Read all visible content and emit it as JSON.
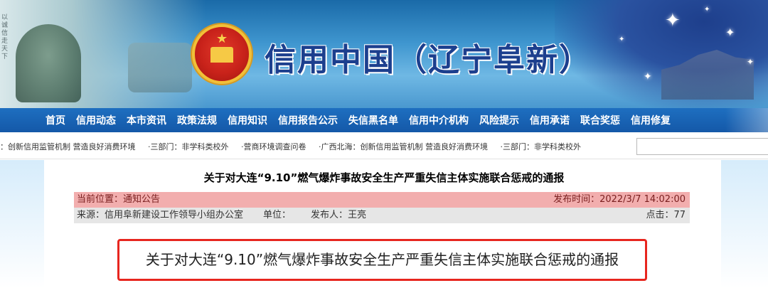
{
  "banner": {
    "site_title": "信用中国（辽宁阜新）",
    "vertical_text": "以诚信走天下"
  },
  "nav": {
    "items": [
      "首页",
      "信用动态",
      "本市资讯",
      "政策法规",
      "信用知识",
      "信用报告公示",
      "失信黑名单",
      "信用中介机构",
      "风险提示",
      "信用承诺",
      "联合奖惩",
      "信用修复"
    ]
  },
  "ticker": {
    "items": [
      "：创新信用监管机制 营造良好消费环境",
      "·三部门：非学科类校外",
      "·营商环境调查问卷",
      "·广西北海：创新信用监管机制 营造良好消费环境",
      "·三部门：非学科类校外"
    ],
    "search_value": ""
  },
  "article": {
    "headline": "关于对大连“9.10”燃气爆炸事故安全生产严重失信主体实施联合惩戒的通报",
    "location_label": "当前位置：",
    "location_value": "通知公告",
    "publish_time_label": "发布时间：",
    "publish_time_value": "2022/3/7 14:02:00",
    "source_label": "来源：",
    "source_value": "信用阜新建设工作领导小组办公室",
    "unit_label": "单位：",
    "unit_value": "",
    "publisher_label": "发布人：",
    "publisher_value": "王亮",
    "clicks_label": "点击：",
    "clicks_value": "77",
    "callout_text": "关于对大连“9.10”燃气爆炸事故安全生产严重失信主体实施联合惩戒的通报"
  },
  "colors": {
    "nav_bg": "#1458a8",
    "title_blue": "#1c3f8e",
    "meta_pink": "#f2aeae",
    "highlight_red": "#e7261f"
  }
}
